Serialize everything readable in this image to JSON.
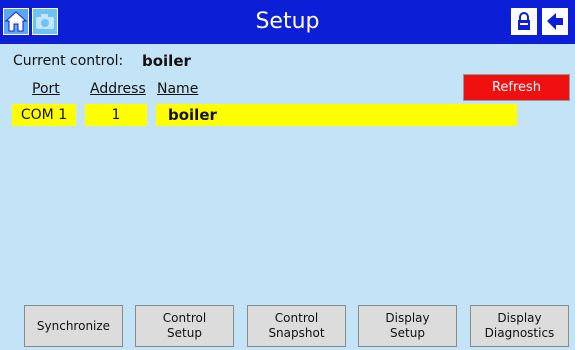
{
  "titlebar": {
    "title": "Setup",
    "color": "#0c1fd6"
  },
  "current_control": {
    "label": "Current control:",
    "value": "boiler"
  },
  "table": {
    "headers": [
      "Port",
      "Address",
      "Name"
    ],
    "rows": [
      {
        "port": "COM 1",
        "address": "1",
        "name": "boiler"
      }
    ]
  },
  "refresh_label": "Refresh",
  "bottom_buttons": [
    {
      "label": "Synchronize"
    },
    {
      "label": "Control\nSetup"
    },
    {
      "label": "Control\nSnapshot"
    },
    {
      "label": "Display\nSetup"
    },
    {
      "label": "Display\nDiagnostics"
    }
  ],
  "icons": [
    "home-icon",
    "camera-icon",
    "lock-icon",
    "back-arrow-icon"
  ],
  "colors": {
    "background": "#c3e4f7",
    "highlight": "#ffff00",
    "refresh": "#f01010"
  }
}
